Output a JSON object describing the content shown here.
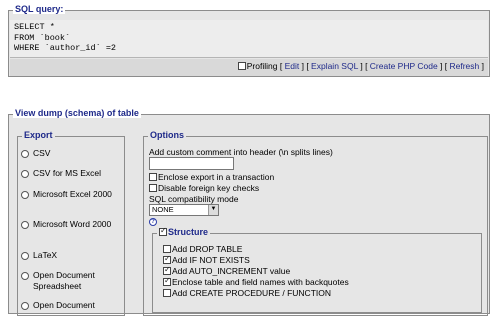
{
  "sql": {
    "legend": "SQL query:",
    "lines": [
      "SELECT *",
      "FROM `book`",
      "WHERE `author_id` =2"
    ],
    "toolbar": {
      "profiling_label": "Profiling",
      "edit": "Edit",
      "explain": "Explain SQL",
      "create_php": "Create PHP Code",
      "refresh": "Refresh"
    }
  },
  "dump": {
    "legend": "View dump (schema) of table",
    "export": {
      "legend": "Export",
      "formats": [
        "CSV",
        "CSV for MS Excel",
        "Microsoft Excel 2000",
        "Microsoft Word 2000",
        "LaTeX",
        "Open Document Spreadsheet",
        "Open Document"
      ]
    },
    "options": {
      "legend": "Options",
      "comment_label": "Add custom comment into header (\\n splits lines)",
      "comment_value": "",
      "enclose_transaction": "Enclose export in a transaction",
      "disable_fk": "Disable foreign key checks",
      "compat_label": "SQL compatibility mode",
      "compat_value": "NONE",
      "structure": {
        "legend": "Structure",
        "items": [
          {
            "label": "Add DROP TABLE",
            "checked": false
          },
          {
            "label": "Add IF NOT EXISTS",
            "checked": true
          },
          {
            "label": "Add AUTO_INCREMENT value",
            "checked": true
          },
          {
            "label": "Enclose table and field names with backquotes",
            "checked": true
          },
          {
            "label": "Add CREATE PROCEDURE / FUNCTION",
            "checked": false
          }
        ]
      }
    }
  },
  "colors": {
    "link": "#1f2a8a",
    "panel_bg": "#e6e6e6"
  }
}
